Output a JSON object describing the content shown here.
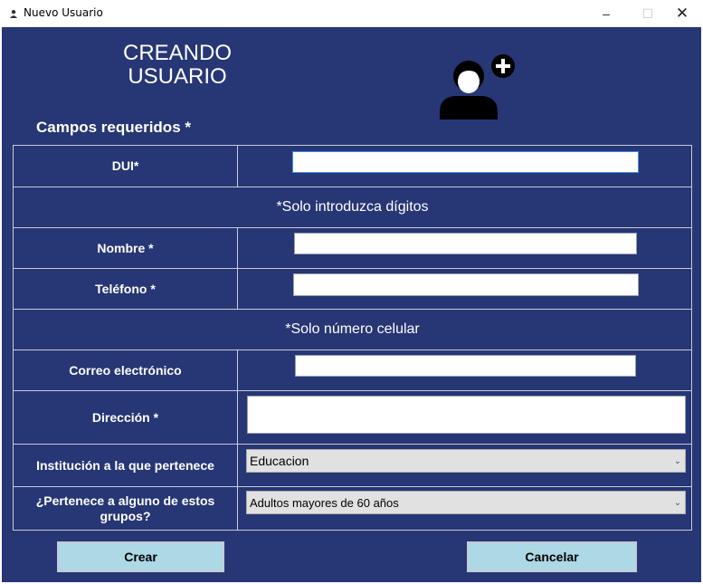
{
  "window": {
    "title": "Nuevo Usuario",
    "minimize_glyph": "–",
    "maximize_glyph": "☐",
    "close_glyph": "✕"
  },
  "header": {
    "title_line1": "CREANDO",
    "title_line2": "USUARIO",
    "icon": "add-user-icon"
  },
  "form": {
    "required_caption": "Campos requeridos *",
    "dui_label": "DUI*",
    "dui_value": "",
    "dui_note": "*Solo introduzca dígitos",
    "nombre_label": "Nombre *",
    "nombre_value": "",
    "telefono_label": "Teléfono  *",
    "telefono_value": "",
    "telefono_note": "*Solo número celular",
    "correo_label": "Correo electrónico",
    "correo_value": "",
    "direccion_label": "Dirección *",
    "direccion_value": "",
    "institucion_label": "Institución a la que pertenece",
    "institucion_selected": "Educacion",
    "grupo_label": "¿Pertenece a  alguno de estos grupos?",
    "grupo_selected": "Adultos mayores de 60 años"
  },
  "buttons": {
    "crear_label": "Crear",
    "cancelar_label": "Cancelar"
  },
  "colors": {
    "background": "#273674",
    "button": "#add8e6",
    "text": "#ffffff"
  }
}
